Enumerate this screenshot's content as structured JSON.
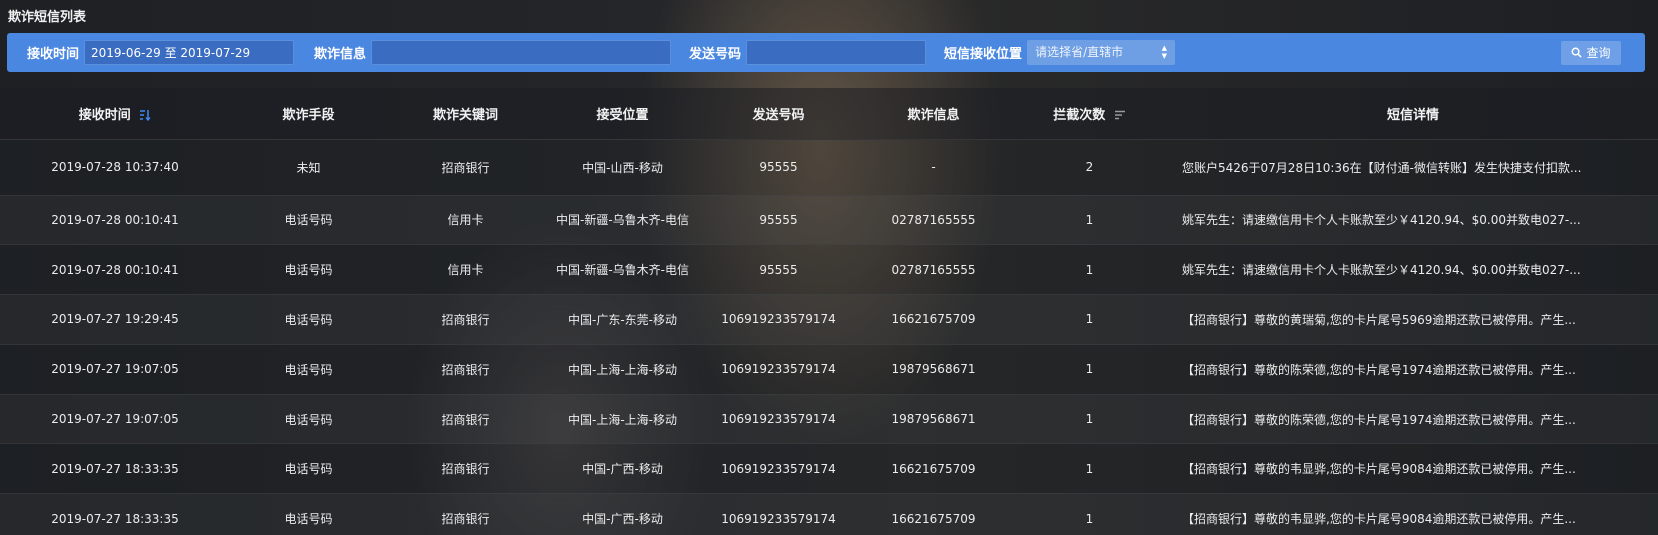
{
  "page": {
    "title": "欺诈短信列表"
  },
  "filters": {
    "time_label": "接收时间",
    "time_value": "2019-06-29 至 2019-07-29",
    "info_label": "欺诈信息",
    "info_value": "",
    "phone_label": "发送号码",
    "phone_value": "",
    "location_label": "短信接收位置",
    "location_placeholder": "请选择省/直辖市",
    "search_label": "查询"
  },
  "table": {
    "columns": [
      "接收时间",
      "欺诈手段",
      "欺诈关键词",
      "接受位置",
      "发送号码",
      "欺诈信息",
      "拦截次数",
      "短信详情"
    ],
    "rows": [
      [
        "2019-07-28 10:37:40",
        "未知",
        "招商银行",
        "中国-山西-移动",
        "95555",
        "-",
        "2",
        "您账户5426于07月28日10:36在【财付通-微信转账】发生快捷支付扣款..."
      ],
      [
        "2019-07-28 00:10:41",
        "电话号码",
        "信用卡",
        "中国-新疆-乌鲁木齐-电信",
        "95555",
        "02787165555",
        "1",
        "姚军先生：请速缴信用卡个人卡账款至少￥4120.94、$0.00并致电027-..."
      ],
      [
        "2019-07-28 00:10:41",
        "电话号码",
        "信用卡",
        "中国-新疆-乌鲁木齐-电信",
        "95555",
        "02787165555",
        "1",
        "姚军先生：请速缴信用卡个人卡账款至少￥4120.94、$0.00并致电027-..."
      ],
      [
        "2019-07-27 19:29:45",
        "电话号码",
        "招商银行",
        "中国-广东-东莞-移动",
        "10691923357917 4",
        "16621675709",
        "1",
        "【招商银行】尊敬的黄瑞菊,您的卡片尾号5969逾期还款已被停用。产生..."
      ],
      [
        "2019-07-27 19:07:05",
        "电话号码",
        "招商银行",
        "中国-上海-上海-移动",
        "106919233579174",
        "19879568671",
        "1",
        "【招商银行】尊敬的陈荣德,您的卡片尾号1974逾期还款已被停用。产生..."
      ],
      [
        "2019-07-27 19:07:05",
        "电话号码",
        "招商银行",
        "中国-上海-上海-移动",
        "106919233579174",
        "19879568671",
        "1",
        "【招商银行】尊敬的陈荣德,您的卡片尾号1974逾期还款已被停用。产生..."
      ],
      [
        "2019-07-27 18:33:35",
        "电话号码",
        "招商银行",
        "中国-广西-移动",
        "106919233579174",
        "16621675709",
        "1",
        "【招商银行】尊敬的韦显骅,您的卡片尾号9084逾期还款已被停用。产生..."
      ],
      [
        "2019-07-27 18:33:35",
        "电话号码",
        "招商银行",
        "中国-广西-移动",
        "106919233579174",
        "16621675709",
        "1",
        "【招商银行】尊敬的韦显骅,您的卡片尾号9084逾期还款已被停用。产生..."
      ]
    ]
  },
  "colors": {
    "accent": "#4a87e0",
    "sort_active": "#3d8cf0"
  }
}
